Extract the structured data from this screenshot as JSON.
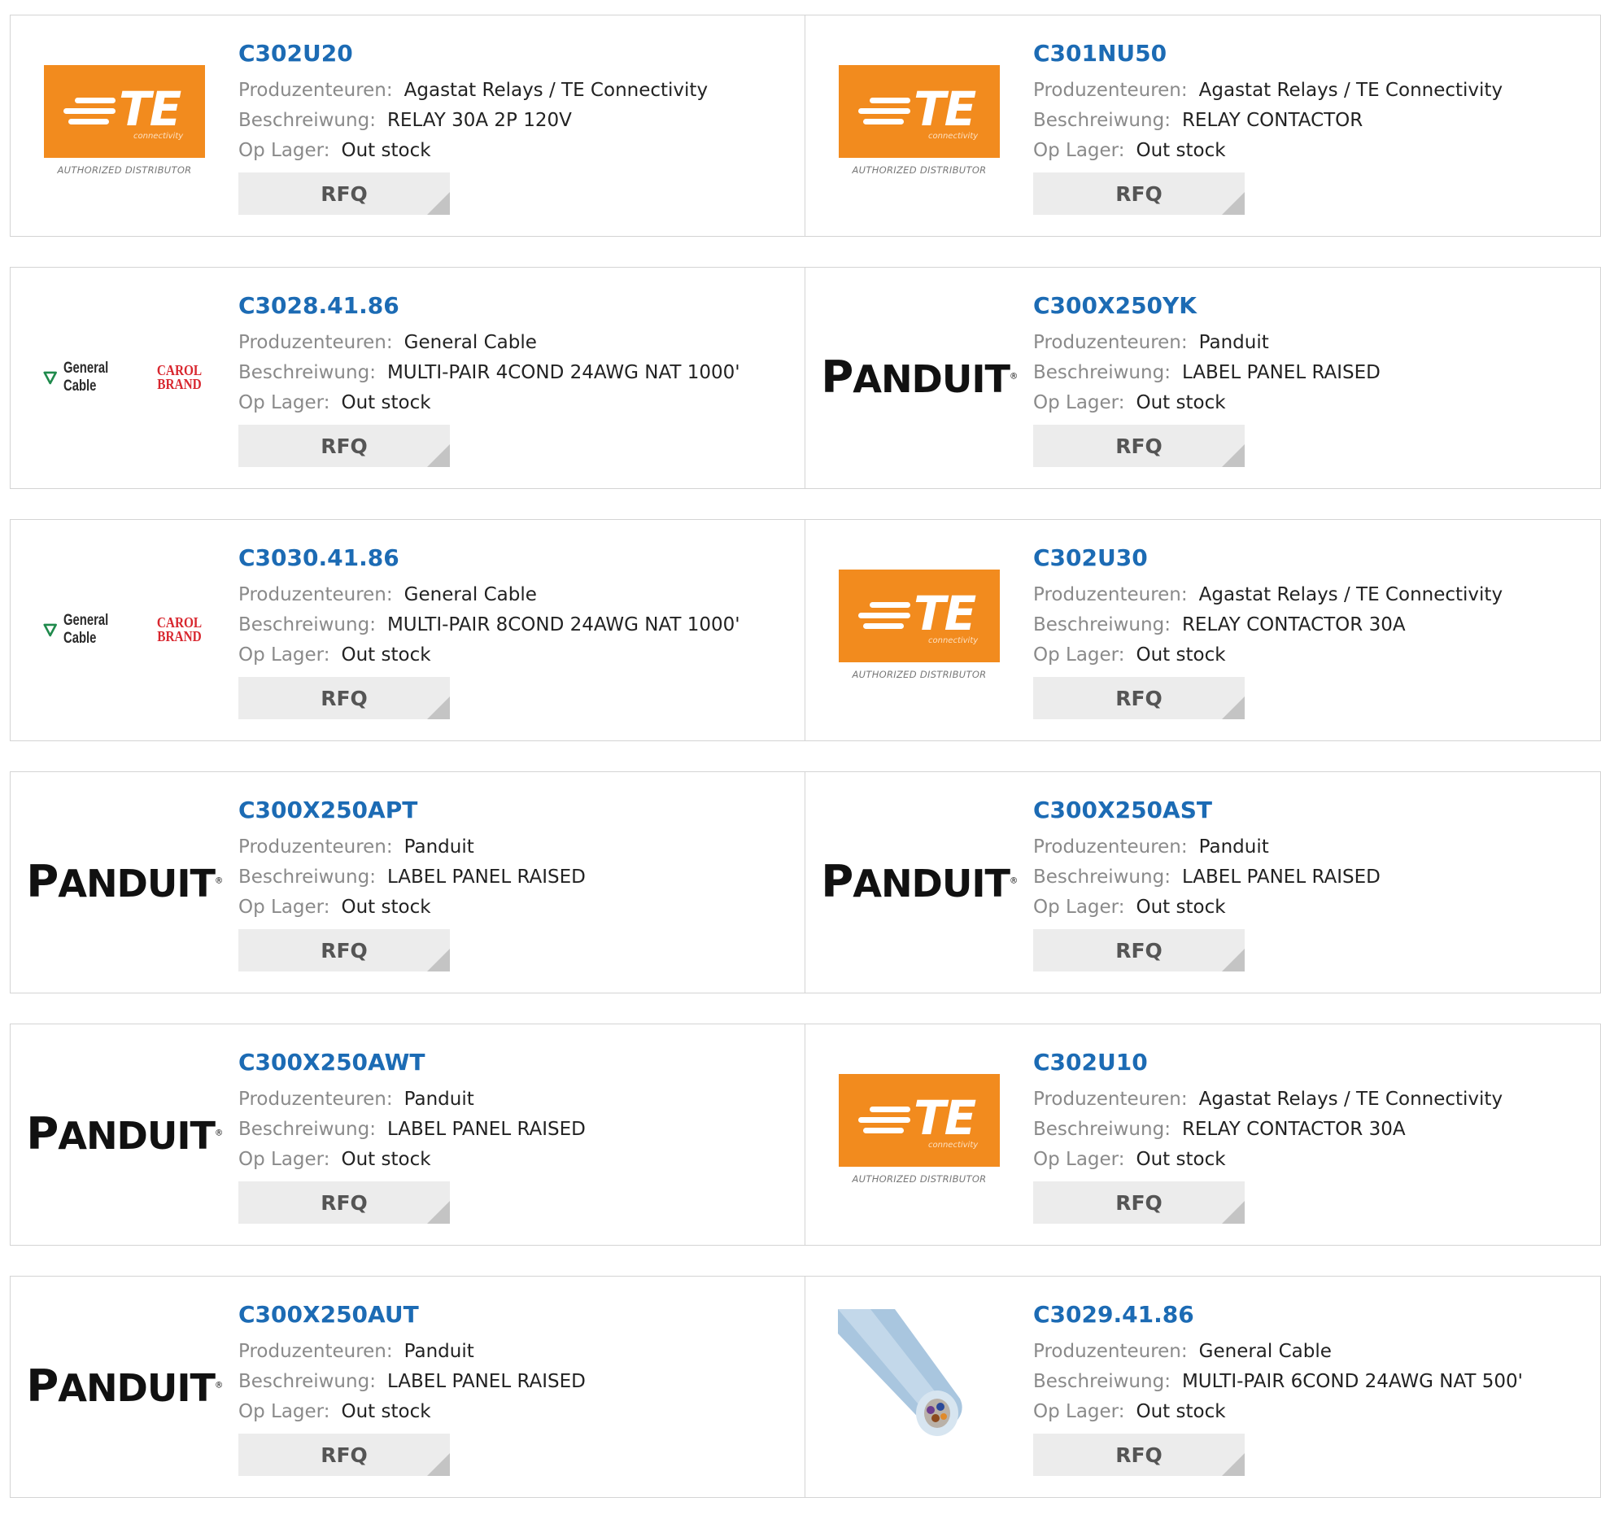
{
  "labels": {
    "manufacturer": "Produzenteuren:",
    "description": "Beschreiwung:",
    "stock": "Op Lager:",
    "rfq": "RFQ"
  },
  "logos": {
    "te": {
      "letters": "TE",
      "tagline": "connectivity",
      "authorized": "AUTHORIZED DISTRIBUTOR",
      "color": "#f28b1e"
    },
    "panduit": {
      "text": "PANDUIT"
    },
    "general_cable": {
      "text": "General Cable",
      "carol": "CAROL",
      "brand": "BRAND"
    }
  },
  "colors": {
    "part_link": "#1c6bb4",
    "label": "#8a8a8a",
    "rfq_bg": "#ececec"
  },
  "rows": [
    [
      {
        "part": "C302U20",
        "manufacturer": "Agastat Relays / TE Connectivity",
        "description": "RELAY 30A 2P 120V",
        "stock": "Out stock",
        "logo": "te"
      },
      {
        "part": "C301NU50",
        "manufacturer": "Agastat Relays / TE Connectivity",
        "description": "RELAY CONTACTOR",
        "stock": "Out stock",
        "logo": "te"
      }
    ],
    [
      {
        "part": "C3028.41.86",
        "manufacturer": "General Cable",
        "description": "MULTI-PAIR 4COND 24AWG NAT 1000'",
        "stock": "Out stock",
        "logo": "general_cable"
      },
      {
        "part": "C300X250YK",
        "manufacturer": "Panduit",
        "description": "LABEL PANEL RAISED",
        "stock": "Out stock",
        "logo": "panduit"
      }
    ],
    [
      {
        "part": "C3030.41.86",
        "manufacturer": "General Cable",
        "description": "MULTI-PAIR 8COND 24AWG NAT 1000'",
        "stock": "Out stock",
        "logo": "general_cable"
      },
      {
        "part": "C302U30",
        "manufacturer": "Agastat Relays / TE Connectivity",
        "description": "RELAY CONTACTOR 30A",
        "stock": "Out stock",
        "logo": "te"
      }
    ],
    [
      {
        "part": "C300X250APT",
        "manufacturer": "Panduit",
        "description": "LABEL PANEL RAISED",
        "stock": "Out stock",
        "logo": "panduit"
      },
      {
        "part": "C300X250AST",
        "manufacturer": "Panduit",
        "description": "LABEL PANEL RAISED",
        "stock": "Out stock",
        "logo": "panduit"
      }
    ],
    [
      {
        "part": "C300X250AWT",
        "manufacturer": "Panduit",
        "description": "LABEL PANEL RAISED",
        "stock": "Out stock",
        "logo": "panduit"
      },
      {
        "part": "C302U10",
        "manufacturer": "Agastat Relays / TE Connectivity",
        "description": "RELAY CONTACTOR 30A",
        "stock": "Out stock",
        "logo": "te"
      }
    ],
    [
      {
        "part": "C300X250AUT",
        "manufacturer": "Panduit",
        "description": "LABEL PANEL RAISED",
        "stock": "Out stock",
        "logo": "panduit"
      },
      {
        "part": "C3029.41.86",
        "manufacturer": "General Cable",
        "description": "MULTI-PAIR 6COND 24AWG NAT 500'",
        "stock": "Out stock",
        "logo": "cable_photo"
      }
    ]
  ]
}
